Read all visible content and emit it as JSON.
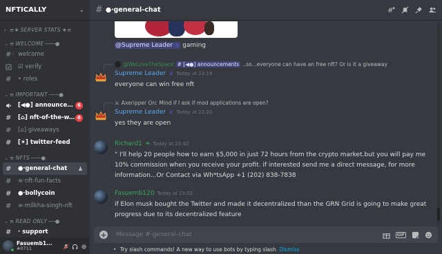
{
  "server": {
    "name": "NFTICALLY"
  },
  "categories": [
    {
      "label": "SERVER STATS",
      "prefix": "≡★",
      "suffix": "★≡"
    },
    {
      "label": "WELCOME",
      "prefix": "≡",
      "suffix": ""
    },
    {
      "label": "IMPORTANT",
      "prefix": "≡",
      "suffix": ""
    },
    {
      "label": "NFTS",
      "prefix": "≡",
      "suffix": ""
    },
    {
      "label": "READ ONLY",
      "prefix": "≡",
      "suffix": ""
    }
  ],
  "channels": {
    "welcome": {
      "label": "welcome",
      "emoji": "·"
    },
    "verify": {
      "label": "verify",
      "emoji": "☑"
    },
    "roles": {
      "label": "roles",
      "emoji": "•"
    },
    "announcements": {
      "label": "announcem...",
      "emoji": "[◀●]",
      "badge": "6"
    },
    "nft_of_the_week": {
      "label": "nft-of-the-w...",
      "emoji": "[⌂]",
      "badge": "6"
    },
    "giveaways": {
      "label": "giveaways",
      "emoji": "[⌂]"
    },
    "twitter_feed": {
      "label": "twitter-feed",
      "emoji": "[✶]"
    },
    "general_chat": {
      "label": "‧general-chat",
      "emoji": "●"
    },
    "nft_fun_facts": {
      "label": "‧nft-fun-facts",
      "emoji": "≡"
    },
    "bollycoin": {
      "label": "‧bollycoin",
      "emoji": "●"
    },
    "milkha_singh_nft": {
      "label": "‧milkha-singh-nft",
      "emoji": "≡"
    },
    "support": {
      "label": "support",
      "emoji": "·"
    }
  },
  "user": {
    "name": "Fasuemb1...",
    "tag": "#0711"
  },
  "header": {
    "title": "‧general-chat"
  },
  "messages": {
    "continuation": {
      "mention": "@Supreme Leader",
      "text": " gaming"
    },
    "m1": {
      "reply_user": "@WeLoveTheSpace",
      "reply_channel": "[◀●] announcements",
      "reply_text": "..so...everyone can have an free nft? Or is it a giveaway",
      "author": "Supreme Leader",
      "time": "Today at 23:19",
      "text": "everyone can win free nft"
    },
    "m2": {
      "reply_user": "Axeripper Orc",
      "reply_text": "Mind if I ask if mod applications are open?",
      "author": "Supreme Leader",
      "time": "Today at 23:20",
      "text": "yes they are open"
    },
    "m3": {
      "author": "Richard1",
      "time": "Today at 23:32",
      "text": "\" I'll help 20 people how to earn $5,000 in just 72 hours from the crypto market.but you will pay me 10% commission when you receive your profit. if interested send me a direct message, for more information...Or  Contact via Wh*tsApp +1 (202) 838-7838"
    },
    "m4": {
      "author": "Fasuemb120",
      "time": "Today at 23:52",
      "text": "if Elon musk bought the Twitter and made it decentralized than the GRN Grid is going to make great progress due to its decentralized feature"
    }
  },
  "composer": {
    "placeholder": "Message #‧general-chat"
  },
  "tip": {
    "text": "Try slash commands! A new way to use bots by typing slash.",
    "dismiss": "Dismiss"
  },
  "colors": {
    "accent": "#5865f2",
    "mention_red": "#ed4245",
    "link": "#00aff4"
  }
}
